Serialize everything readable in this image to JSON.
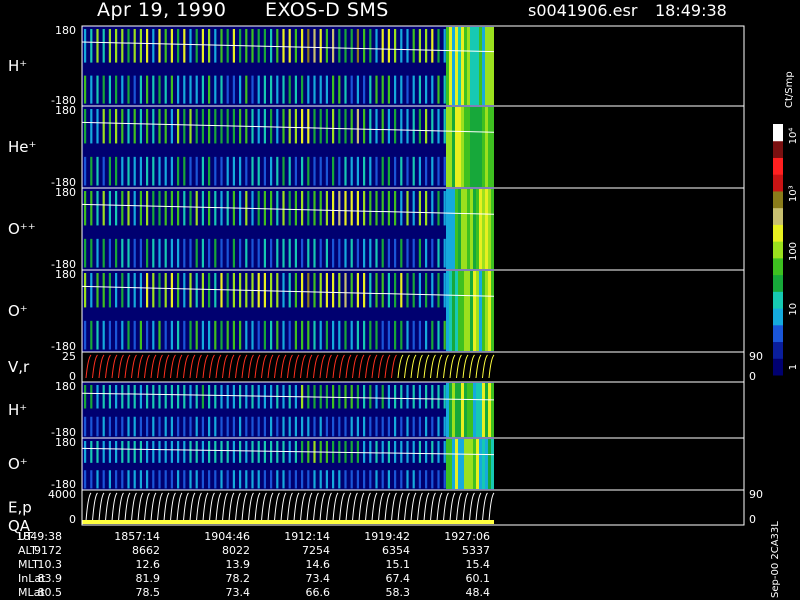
{
  "header": {
    "date": "Apr 19, 1990",
    "instrument": "EXOS-D SMS",
    "file": "s0041906.esr",
    "time": "18:49:38"
  },
  "colors": {
    "background": "#000000",
    "frame": "#ffffff",
    "trace": "#ffffff",
    "qa_bar": "#ffff40",
    "colorbar": [
      "#000070",
      "#0a1e9c",
      "#1a56d8",
      "#15aadd",
      "#17c9b3",
      "#17a83a",
      "#3ec020",
      "#9be01e",
      "#e8f020",
      "#c8c070",
      "#8a7c1a",
      "#c81414",
      "#ff2020",
      "#7a1010",
      "#ffffff"
    ]
  },
  "colorbar": {
    "title": "Ct/Smp",
    "ticks": [
      "1",
      "10",
      "100",
      "10³",
      "10⁴"
    ]
  },
  "chart_data": {
    "type": "heatmap",
    "x_axis": {
      "ticks": [
        "1849:38",
        "1857:14",
        "1904:46",
        "1912:14",
        "1919:42",
        "1927:06"
      ]
    },
    "panels": [
      {
        "name": "H⁺",
        "kind": "pitch",
        "ylim": [
          -180,
          180
        ],
        "yticks": [
          "180",
          "-180"
        ]
      },
      {
        "name": "He⁺",
        "kind": "pitch",
        "ylim": [
          -180,
          180
        ],
        "yticks": [
          "180",
          "-180"
        ]
      },
      {
        "name": "O⁺⁺",
        "kind": "pitch",
        "ylim": [
          -180,
          180
        ],
        "yticks": [
          "180",
          "-180"
        ]
      },
      {
        "name": "O⁺",
        "kind": "pitch",
        "ylim": [
          -180,
          180
        ],
        "yticks": [
          "180",
          "-180"
        ]
      },
      {
        "name": "V,r",
        "kind": "trace",
        "ylim": [
          0,
          25
        ],
        "yticks": [
          "25",
          "0"
        ],
        "right_ticks": [
          "90",
          "0"
        ]
      },
      {
        "name": "H⁺",
        "kind": "pitch",
        "ylim": [
          -180,
          180
        ],
        "yticks": [
          "180",
          "-180"
        ]
      },
      {
        "name": "O⁺",
        "kind": "pitch",
        "ylim": [
          -180,
          180
        ],
        "yticks": [
          "180",
          "-180"
        ]
      },
      {
        "name": "E,p",
        "name2": "QA",
        "kind": "trace",
        "ylim": [
          0,
          4000
        ],
        "yticks": [
          "4000",
          "0"
        ],
        "right_ticks": [
          "90",
          "0"
        ]
      }
    ]
  },
  "table": {
    "rows": [
      {
        "label": "UT",
        "values": [
          "1849:38",
          "1857:14",
          "1904:46",
          "1912:14",
          "1919:42",
          "1927:06"
        ]
      },
      {
        "label": "ALT",
        "values": [
          "9172",
          "8662",
          "8022",
          "7254",
          "6354",
          "5337"
        ]
      },
      {
        "label": "MLT",
        "values": [
          "10.3",
          "12.6",
          "13.9",
          "14.6",
          "15.1",
          "15.4"
        ]
      },
      {
        "label": "InLat",
        "values": [
          "83.9",
          "81.9",
          "78.2",
          "73.4",
          "67.4",
          "60.1"
        ]
      },
      {
        "label": "MLat",
        "values": [
          "80.5",
          "78.5",
          "73.4",
          "66.6",
          "58.3",
          "48.4"
        ]
      }
    ]
  },
  "footer": {
    "stamp": "Sep-00 2CA33L"
  }
}
